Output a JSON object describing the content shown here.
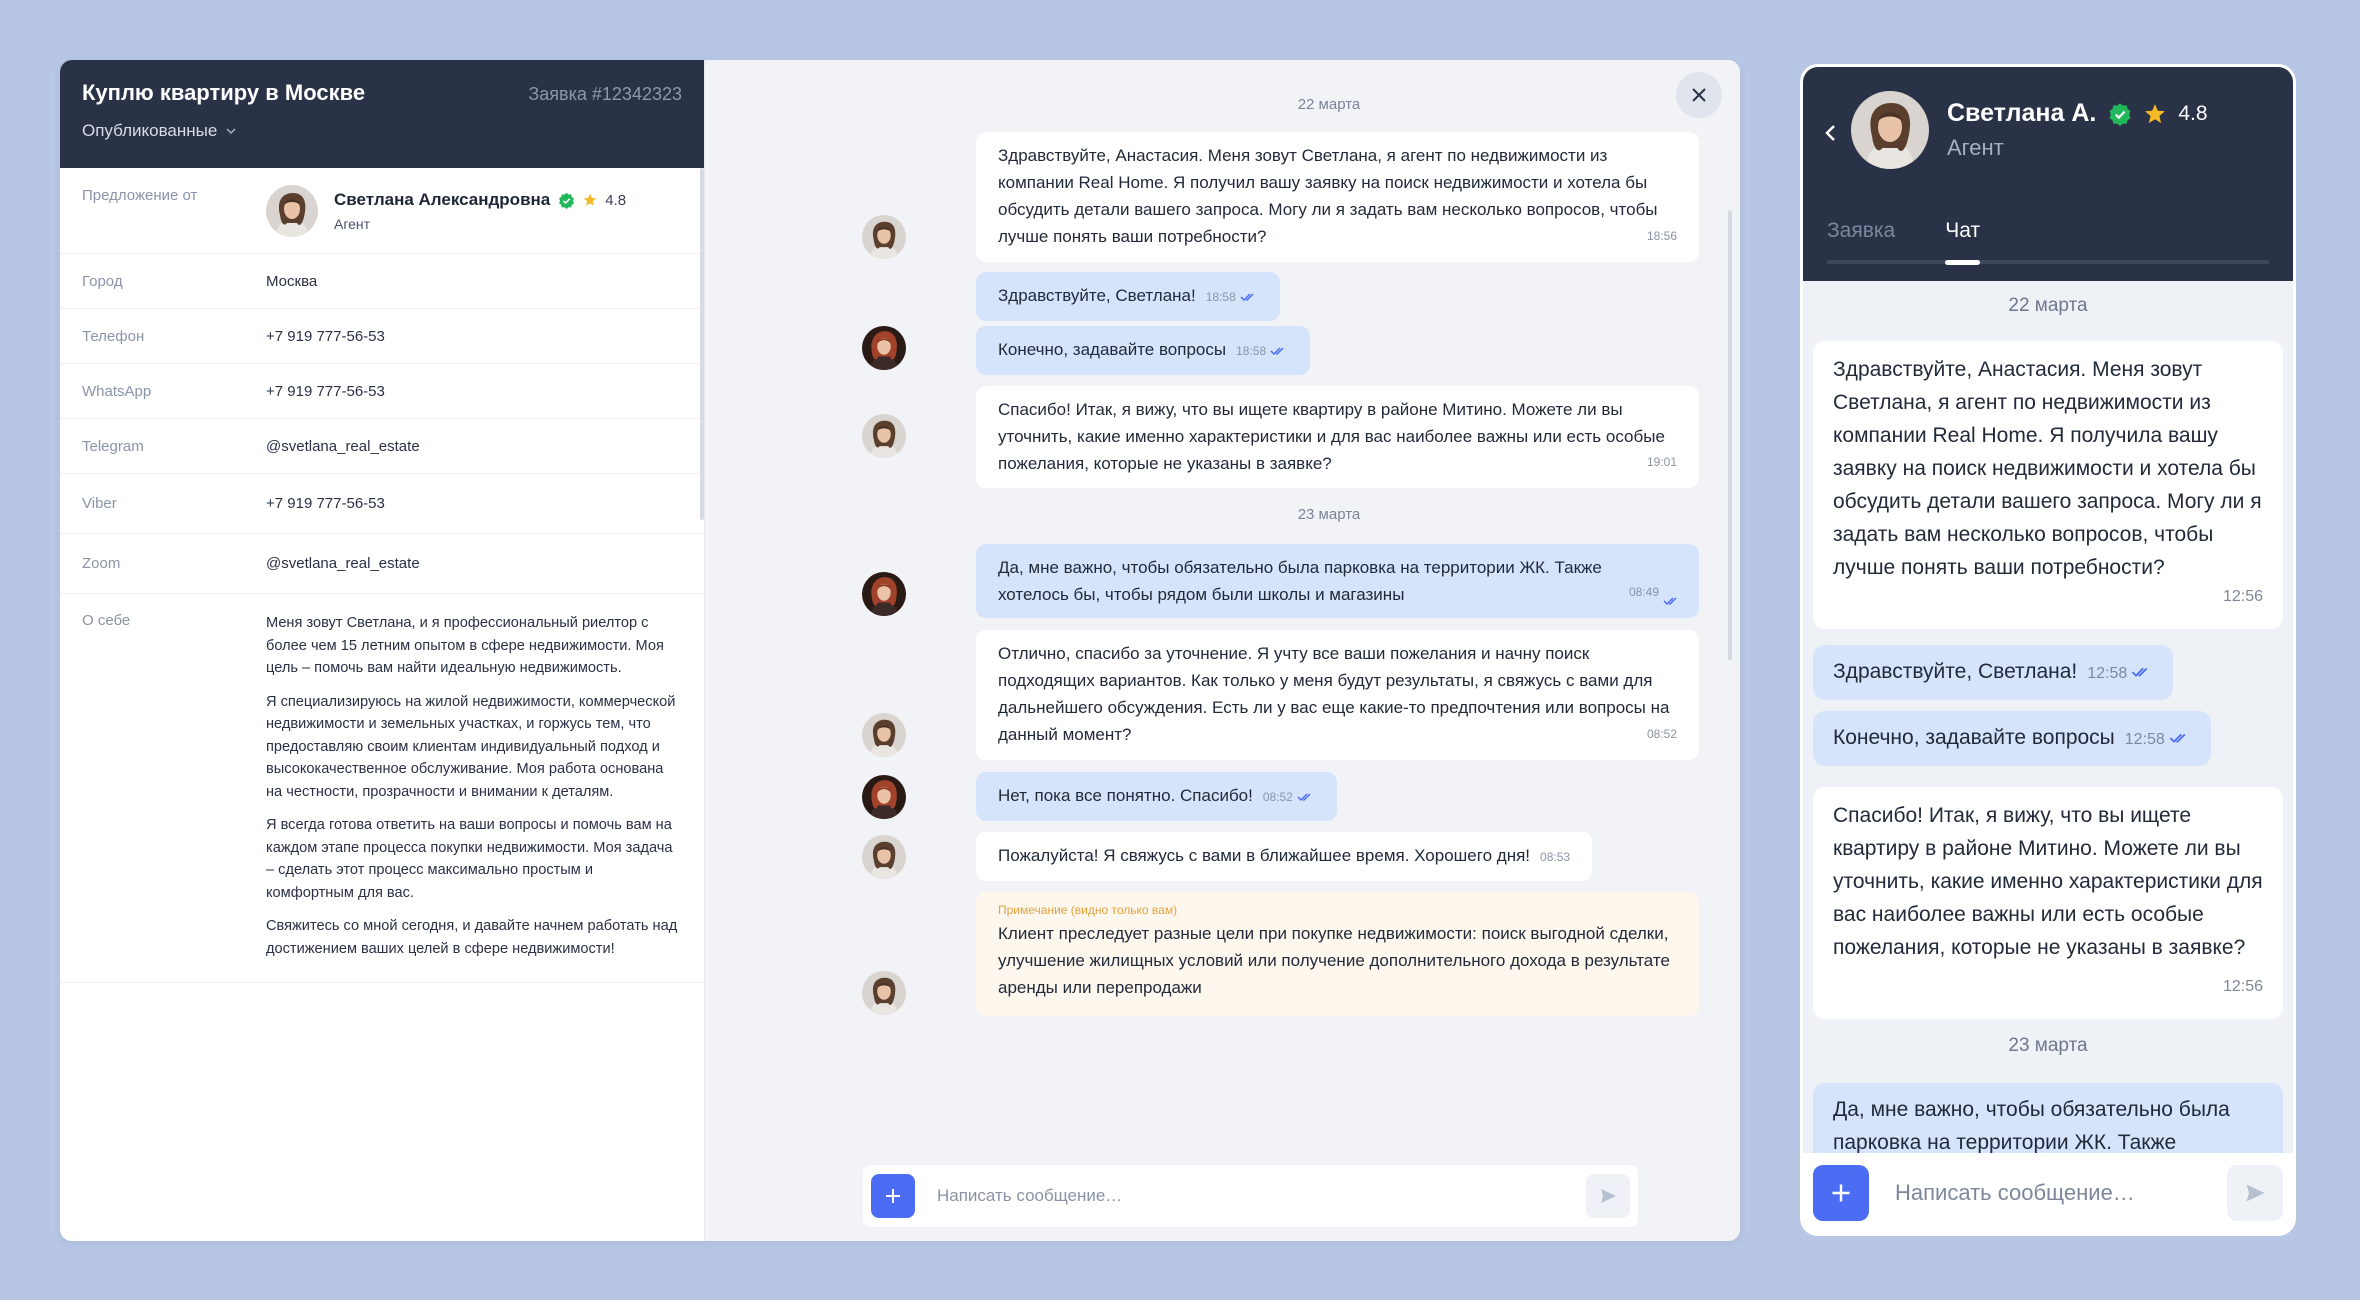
{
  "request": {
    "title": "Куплю квартиру в Москве",
    "number": "Заявка #12342323",
    "status": "Опубликованные"
  },
  "agent": {
    "offer_label": "Предложение от",
    "name": "Светлана Александровна",
    "rating": "4.8",
    "role": "Агент"
  },
  "contacts": [
    {
      "label": "Город",
      "value": "Москва"
    },
    {
      "label": "Телефон",
      "value": "+7 919 777-56-53"
    },
    {
      "label": "WhatsApp",
      "value": "+7 919 777-56-53"
    },
    {
      "label": "Telegram",
      "value": "@svetlana_real_estate"
    },
    {
      "label": "Viber",
      "value": "+7 919 777-56-53"
    },
    {
      "label": "Zoom",
      "value": "@svetlana_real_estate"
    }
  ],
  "about": {
    "label": "О себе",
    "paragraphs": [
      "Меня зовут Светлана, и я профессиональный риелтор с более чем 15 летним опытом в сфере недвижимости. Моя цель – помочь вам найти идеальную недвижимость.",
      "Я специализируюсь на жилой недвижимости, коммерческой недвижимости и земельных участках, и горжусь тем, что предоставляю своим клиентам индивидуальный подход и высококачественное обслуживание. Моя работа основана на честности, прозрачности и внимании к деталям.",
      "Я всегда готова ответить на ваши вопросы и помочь вам на каждом этапе процесса покупки недвижимости. Моя задача – сделать этот процесс максимально простым и комфортным для вас.",
      " Свяжитесь со мной сегодня, и давайте начнем работать над достижением ваших целей в сфере недвижимости!"
    ]
  },
  "chat": {
    "date1": "22 марта",
    "date2": "23 марта",
    "messages": [
      {
        "text": "Здравствуйте, Анастасия. Меня зовут Светлана, я агент по недвижимости из компании Real Home. Я получил вашу заявку на поиск недвижимости и хотела бы обсудить детали вашего запроса. Могу ли я задать вам несколько вопросов, чтобы лучше понять ваши потребности?",
        "time": "18:56"
      },
      {
        "text": "Здравствуйте, Светлана!",
        "time": "18:58"
      },
      {
        "text": "Конечно, задавайте вопросы",
        "time": "18:58"
      },
      {
        "text": "Спасибо! Итак, я вижу, что вы ищете квартиру в районе Митино. Можете ли вы уточнить, какие именно характеристики и для вас наиболее важны или есть особые пожелания, которые не указаны в заявке?",
        "time": "19:01"
      },
      {
        "text": "Да, мне важно, чтобы обязательно была парковка на территории ЖК. Также хотелось бы, чтобы рядом были школы и магазины",
        "time": "08:49"
      },
      {
        "text": "Отлично, спасибо за уточнение. Я учту все ваши пожелания и начну поиск подходящих вариантов. Как только у меня будут результаты, я свяжусь с вами для дальнейшего обсуждения. Есть ли у вас еще какие-то предпочтения или вопросы на данный момент?",
        "time": "08:52"
      },
      {
        "text": "Нет, пока все понятно. Спасибо!",
        "time": "08:52"
      },
      {
        "text": "Пожалуйста! Я свяжусь с вами в ближайшее время. Хорошего дня!",
        "time": "08:53"
      }
    ],
    "note": {
      "label": "Примечание (видно только вам)",
      "text": "Клиент преследует разные цели при покупке недвижимости: поиск выгодной сделки, улучшение жилищных условий или получение дополнительного дохода в результате аренды или перепродажи"
    },
    "placeholder": "Написать сообщение…"
  },
  "mobile": {
    "name": "Светлана А.",
    "rating": "4.8",
    "role": "Агент",
    "tabs": [
      "Заявка",
      "Чат"
    ],
    "date1": "22 марта",
    "date2": "23 марта",
    "messages": [
      {
        "text": "Здравствуйте, Анастасия. Меня зовут Светлана, я агент по недвижимости из компании Real Home. Я получила вашу заявку на поиск недвижимости и хотела бы обсудить детали вашего запроса. Могу ли я задать вам несколько вопросов, чтобы лучше понять ваши потребности?",
        "time": "12:56"
      },
      {
        "text": "Здравствуйте, Светлана!",
        "time": "12:58"
      },
      {
        "text": "Конечно, задавайте вопросы",
        "time": "12:58"
      },
      {
        "text": "Спасибо! Итак, я вижу, что вы ищете квартиру в районе Митино. Можете ли вы уточнить, какие именно характеристики для вас наиболее важны или есть особые пожелания, которые не указаны в заявке?",
        "time": "12:56"
      },
      {
        "text": "Да, мне важно, чтобы обязательно была парковка на территории ЖК. Также"
      }
    ],
    "placeholder": "Написать сообщение…"
  },
  "colors": {
    "header_bg": "#2a3247",
    "accent": "#4b6cf3",
    "outgoing_bubble": "#d6e4fb",
    "note_bubble": "#fdf7ee",
    "verified": "#20b85a",
    "star": "#f6b928"
  }
}
